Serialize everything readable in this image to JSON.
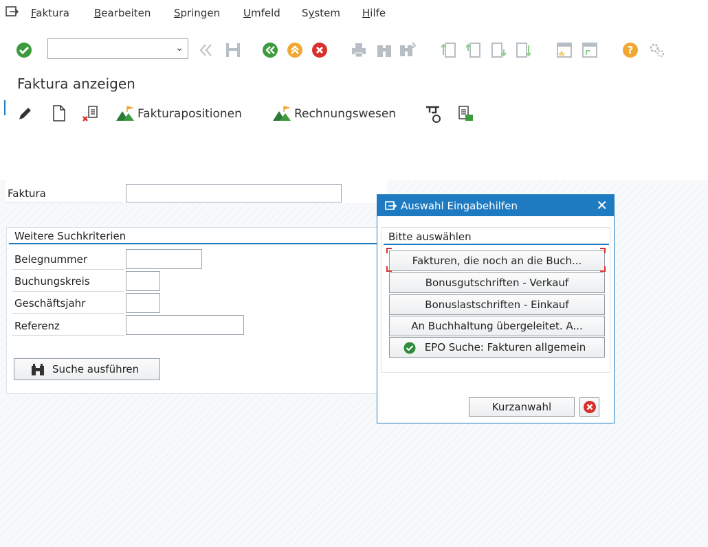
{
  "menu": {
    "items": [
      {
        "label": "Faktura",
        "accel": "F",
        "rest": "aktura"
      },
      {
        "label": "Bearbeiten",
        "accel": "B",
        "rest": "earbeiten"
      },
      {
        "label": "Springen",
        "accel": "S",
        "rest": "pringen"
      },
      {
        "label": "Umfeld",
        "accel": "U",
        "rest": "mfeld"
      },
      {
        "label": "System",
        "accel": "y",
        "pre": "S",
        "rest": "stem"
      },
      {
        "label": "Hilfe",
        "accel": "H",
        "rest": "ilfe"
      }
    ]
  },
  "toolbar": {
    "command_field_value": "",
    "dropdown_glyph": "⌄"
  },
  "title": "Faktura anzeigen",
  "app_toolbar": {
    "fakturapositionen": "Fakturapositionen",
    "rechnungswesen": "Rechnungswesen"
  },
  "form": {
    "faktura_label": "Faktura",
    "faktura_value": ""
  },
  "group": {
    "title": "Weitere Suchkriterien",
    "fields": [
      {
        "label": "Belegnummer",
        "value": ""
      },
      {
        "label": "Buchungskreis",
        "value": ""
      },
      {
        "label": "Geschäftsjahr",
        "value": ""
      },
      {
        "label": "Referenz",
        "value": ""
      }
    ],
    "search_button": "Suche ausführen"
  },
  "dialog": {
    "title": "Auswahl Eingabehilfen",
    "close": "✕",
    "subtitle": "Bitte auswählen",
    "options": [
      "Fakturen, die noch an die Buch...",
      "Bonusgutschriften - Verkauf",
      "Bonuslastschriften - Einkauf",
      "An Buchhaltung übergeleitet. A...",
      "EPO Suche: Fakturen allgemein"
    ],
    "kurzanwahl": "Kurzanwahl"
  },
  "colors": {
    "accent": "#1f7bc1",
    "green": "#3c9b3c",
    "red": "#d9302c",
    "orange": "#f0a830"
  }
}
